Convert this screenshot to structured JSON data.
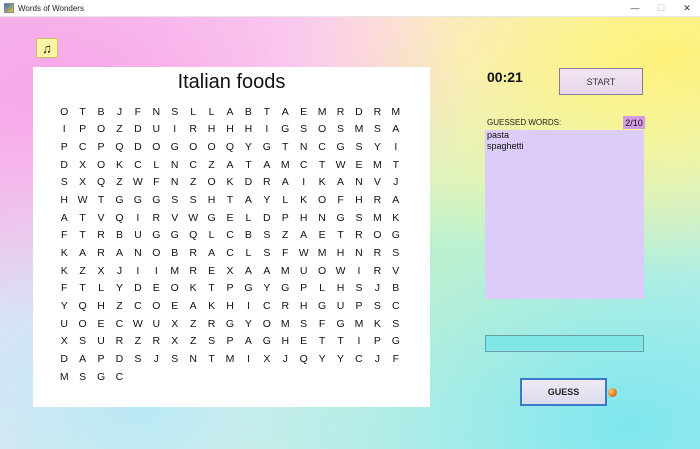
{
  "window": {
    "title": "Words of Wonders"
  },
  "controls": {
    "minimize": "—",
    "maximize": "☐",
    "close": "✕"
  },
  "music_button": {
    "glyph": "♫"
  },
  "board": {
    "title": "Italian foods",
    "rows": [
      [
        "O",
        "T",
        "B",
        "J",
        "F",
        "N",
        "S",
        "L",
        "L",
        "A",
        "B",
        "T",
        "A",
        "E",
        "M",
        "R",
        "D"
      ],
      [
        "R",
        "M",
        "I",
        "P",
        "O",
        "Z",
        "D",
        "U",
        "I",
        "R",
        "H",
        "H",
        "H",
        "I",
        "G",
        "S",
        "O"
      ],
      [
        "S",
        "M",
        "S",
        "A",
        "P",
        "C",
        "P",
        "Q",
        "D",
        "O",
        "G",
        "O",
        "O",
        "Q",
        "Y",
        "G",
        "T"
      ],
      [
        "N",
        "C",
        "G",
        "S",
        "Y",
        "I",
        "D",
        "X",
        "O",
        "K",
        "C",
        "L",
        "N",
        "C",
        "Z",
        "A",
        "T"
      ],
      [
        "A",
        "M",
        "C",
        "T",
        "W",
        "E",
        "M",
        "T",
        "S",
        "X",
        "Q",
        "Z",
        "W",
        "F",
        "N",
        "Z",
        "O"
      ],
      [
        "K",
        "D",
        "R",
        "A",
        "I",
        "K",
        "A",
        "N",
        "V",
        "J",
        "H",
        "W",
        "T",
        "G",
        "G",
        "G",
        "S"
      ],
      [
        "S",
        "H",
        "T",
        "A",
        "Y",
        "L",
        "K",
        "O",
        "F",
        "H",
        "R",
        "A",
        "A",
        "T",
        "V",
        "Q",
        "I"
      ],
      [
        "R",
        "V",
        "W",
        "G",
        "E",
        "L",
        "D",
        "P",
        "H",
        "N",
        "G",
        "S",
        "M",
        "K",
        "F",
        "T",
        "R"
      ],
      [
        "B",
        "U",
        "G",
        "G",
        "Q",
        "L",
        "C",
        "B",
        "S",
        "Z",
        "A",
        "E",
        "T",
        "R",
        "O",
        "G",
        "K"
      ],
      [
        "A",
        "R",
        "A",
        "N",
        "O",
        "B",
        "R",
        "A",
        "C",
        "L",
        "S",
        "F",
        "W",
        "M",
        "H",
        "N",
        "R"
      ],
      [
        "S",
        "K",
        "Z",
        "X",
        "J",
        "I",
        "I",
        "M",
        "R",
        "E",
        "X",
        "A",
        "A",
        "M",
        "U",
        "O",
        "W"
      ],
      [
        "I",
        "R",
        "V",
        "F",
        "T",
        "L",
        "Y",
        "D",
        "E",
        "O",
        "K",
        "T",
        "P",
        "G",
        "Y",
        "G",
        "P"
      ],
      [
        "L",
        "H",
        "S",
        "J",
        "B",
        "Y",
        "Q",
        "H",
        "Z",
        "C",
        "O",
        "E",
        "A",
        "K",
        "H",
        "I",
        "C"
      ],
      [
        "R",
        "H",
        "G",
        "U",
        "P",
        "S",
        "C",
        "U",
        "O",
        "E",
        "C",
        "W",
        "U",
        "X",
        "Z",
        "R",
        "G"
      ],
      [
        "Y",
        "O",
        "M",
        "S",
        "F",
        "G",
        "M",
        "K",
        "S",
        "X",
        "S",
        "U",
        "R",
        "Z",
        "R",
        "X",
        "Z"
      ],
      [
        "S",
        "P",
        "A",
        "G",
        "H",
        "E",
        "T",
        "T",
        "I",
        "P",
        "G",
        "D",
        "A",
        "P",
        "D",
        "S",
        "J"
      ],
      [
        "S",
        "N",
        "T",
        "M",
        "I",
        "X",
        "J",
        "Q",
        "Y",
        "Y",
        "C",
        "J",
        "F",
        "M",
        "S",
        "G",
        "C"
      ]
    ]
  },
  "timer": {
    "value": "00:21"
  },
  "start_button": {
    "label": "START"
  },
  "guessed": {
    "label": "GUESSED WORDS:",
    "count": "2/10",
    "words": [
      "pasta",
      "spaghetti"
    ]
  },
  "guess_input": {
    "value": ""
  },
  "guess_button": {
    "label": "GUESS"
  },
  "colors": {
    "guessed_box": "#dcccf9",
    "guess_count_bg": "#d49be5",
    "guess_input_bg": "#80e7e6",
    "music_button_bg": "#fdf5a6",
    "status_dot": "#e07b15"
  }
}
